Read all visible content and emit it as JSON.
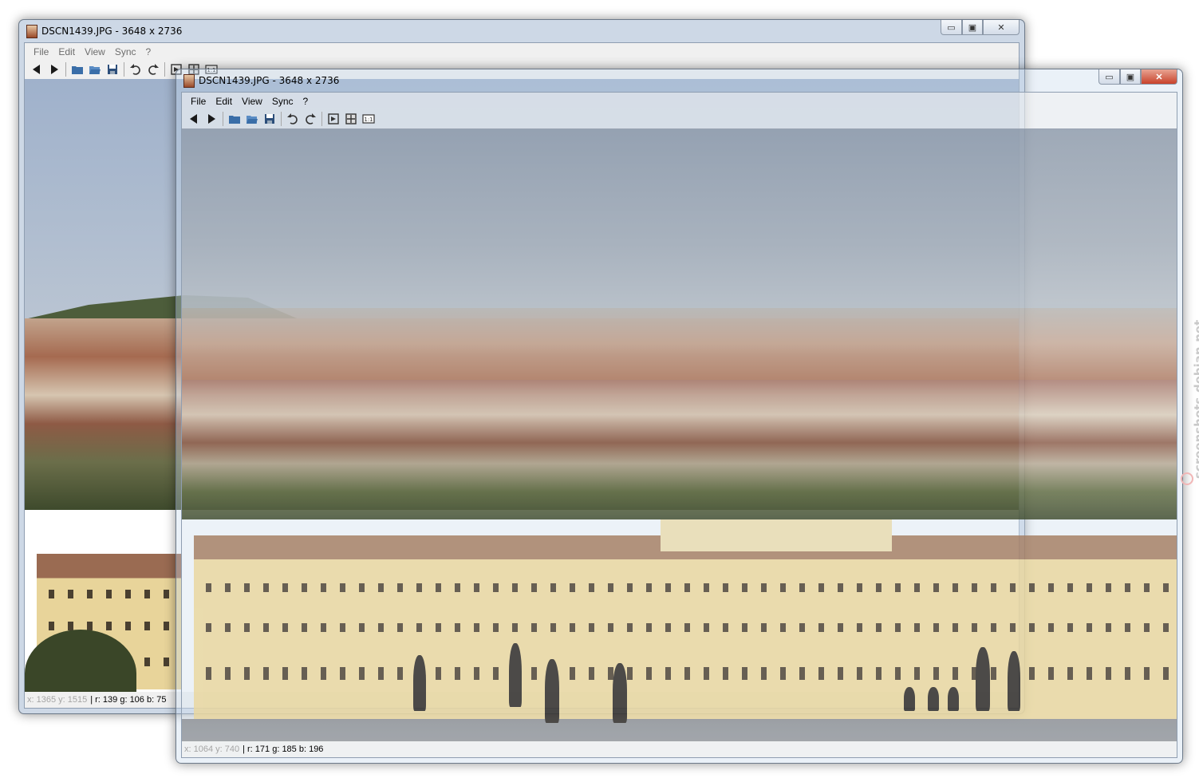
{
  "windows": {
    "back": {
      "title": "DSCN1439.JPG - 3648 x 2736",
      "menu": [
        "File",
        "Edit",
        "View",
        "Sync",
        "?"
      ],
      "status": {
        "coords": "x: 1365 y: 1515",
        "rgb": "| r: 139 g: 106 b: 75"
      }
    },
    "front": {
      "title": "DSCN1439.JPG - 3648 x 2736",
      "menu": [
        "File",
        "Edit",
        "View",
        "Sync",
        "?"
      ],
      "status": {
        "coords": "x: 1064 y: 740",
        "rgb": "| r: 171 g: 185 b: 196"
      }
    }
  },
  "caption_buttons": {
    "minimize": "▭",
    "maximize": "▣",
    "close": "✕"
  },
  "toolbar_icons": [
    "previous-icon",
    "next-icon",
    "open-icon",
    "open-folder-icon",
    "save-icon",
    "rotate-left-icon",
    "rotate-right-icon",
    "fit-window-icon",
    "fullscreen-icon",
    "actual-size-icon"
  ],
  "toolbar_actual_size_label": "1:1",
  "watermark": "screenshots.debian.net",
  "colors": {
    "sky": "#a4b3c7",
    "palace": "#e8d49a",
    "roof": "#8a5a44",
    "trees": "#3c4a2a"
  }
}
